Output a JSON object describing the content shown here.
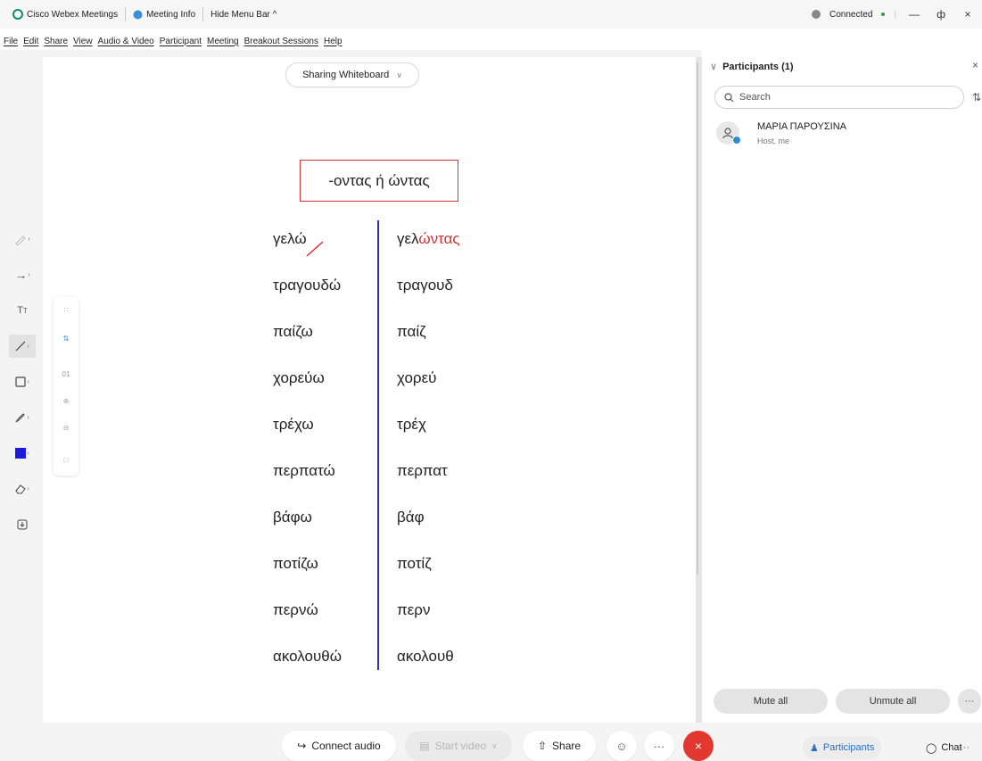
{
  "titlebar": {
    "app_name": "Cisco Webex Meetings",
    "meeting_info": "Meeting Info",
    "hide_menu": "Hide Menu Bar ^",
    "status": "Connected",
    "minimize": "—",
    "restore": "ф",
    "close": "×"
  },
  "menu": [
    "File",
    "Edit",
    "Share",
    "View",
    "Audio & Video",
    "Participant",
    "Meeting",
    "Breakout Sessions",
    "Help"
  ],
  "share": {
    "label": "Sharing Whiteboard",
    "chevron": "∨"
  },
  "toolbar": {
    "subtools_zoom": "01"
  },
  "whiteboard": {
    "title": "-οντας ή ώντας",
    "rows": [
      {
        "left": "γελώ",
        "right_stem": "γελ",
        "right_suffix": "ώντας"
      },
      {
        "left": "τραγουδώ",
        "right_stem": "τραγουδ",
        "right_suffix": ""
      },
      {
        "left": "παίζω",
        "right_stem": "παίζ",
        "right_suffix": ""
      },
      {
        "left": "χορεύω",
        "right_stem": "χορεύ",
        "right_suffix": ""
      },
      {
        "left": "τρέχω",
        "right_stem": "τρέχ",
        "right_suffix": ""
      },
      {
        "left": "περπατώ",
        "right_stem": "περπατ",
        "right_suffix": ""
      },
      {
        "left": "βάφω",
        "right_stem": "βάφ",
        "right_suffix": ""
      },
      {
        "left": "ποτίζω",
        "right_stem": "ποτίζ",
        "right_suffix": ""
      },
      {
        "left": "περνώ",
        "right_stem": "περν",
        "right_suffix": ""
      },
      {
        "left": "ακολουθώ",
        "right_stem": "ακολουθ",
        "right_suffix": ""
      }
    ],
    "colors": {
      "title_border": "#d93030",
      "divider": "#2f2fc8",
      "suffix": "#d93030"
    }
  },
  "panel": {
    "title": "Participants (1)",
    "search_placeholder": "Search",
    "participant": {
      "name": "ΜΑΡΙΑ ΠΑΡΟΥΣΙΝΑ",
      "role": "Host, me"
    },
    "mute_all": "Mute all",
    "unmute_all": "Unmute all",
    "more": "···"
  },
  "bottom": {
    "connect_audio": "Connect audio",
    "start_video": "Start video",
    "share": "Share",
    "more": "···",
    "participants": "Participants",
    "chat": "Chat",
    "end_color": "#e3382f"
  }
}
